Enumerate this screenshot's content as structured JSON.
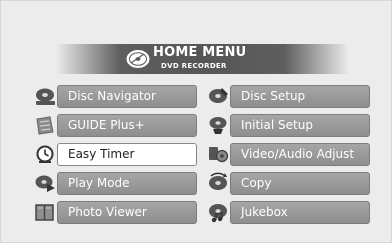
{
  "header": {
    "title": "HOME MENU",
    "subtitle": "DVD RECORDER",
    "logo_icon": "disc-icon"
  },
  "colors": {
    "background": "#ececec",
    "banner": "#5e5e5e",
    "item": "#9a9a9a",
    "selected_item": "#ffffff",
    "label": "#ffffff",
    "selected_label": "#222222"
  },
  "menu": {
    "left": [
      {
        "label": "Disc Navigator",
        "icon": "disc-navigator-icon",
        "selected": false
      },
      {
        "label": "GUIDE Plus+",
        "icon": "guide-plus-icon",
        "selected": false
      },
      {
        "label": "Easy Timer",
        "icon": "clock-icon",
        "selected": true
      },
      {
        "label": "Play Mode",
        "icon": "play-mode-icon",
        "selected": false
      },
      {
        "label": "Photo Viewer",
        "icon": "photo-viewer-icon",
        "selected": false
      }
    ],
    "right": [
      {
        "label": "Disc Setup",
        "icon": "disc-setup-icon",
        "selected": false
      },
      {
        "label": "Initial Setup",
        "icon": "initial-setup-icon",
        "selected": false
      },
      {
        "label": "Video/Audio Adjust",
        "icon": "video-audio-adjust-icon",
        "selected": false
      },
      {
        "label": "Copy",
        "icon": "copy-icon",
        "selected": false
      },
      {
        "label": "Jukebox",
        "icon": "jukebox-icon",
        "selected": false
      }
    ]
  }
}
